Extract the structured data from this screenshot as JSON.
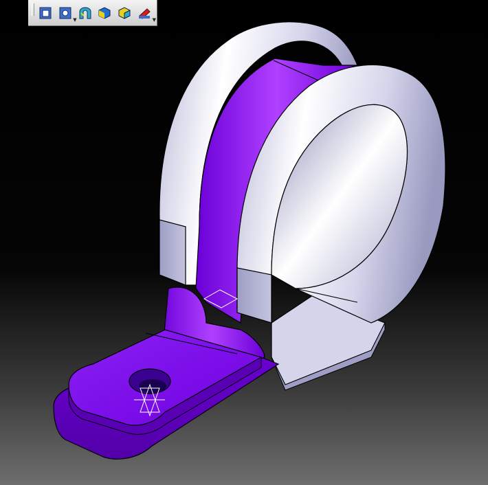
{
  "viewport": {
    "background_top": "#000000",
    "background_bottom": "#6e6e6e"
  },
  "toolbar": {
    "items": [
      {
        "icon": "view-front-icon",
        "has_dropdown": false
      },
      {
        "icon": "view-iso-dropdown-icon",
        "has_dropdown": true
      },
      {
        "icon": "shading-edges-icon",
        "has_dropdown": false
      },
      {
        "icon": "shading-icon",
        "has_dropdown": false
      },
      {
        "icon": "shading-with-edges-icon",
        "has_dropdown": false
      },
      {
        "icon": "render-material-dropdown-icon",
        "has_dropdown": true
      }
    ]
  },
  "part": {
    "clamp_color": "#e8e8f8",
    "rubber_color": "#7a0de8",
    "edge_color": "#000000"
  }
}
